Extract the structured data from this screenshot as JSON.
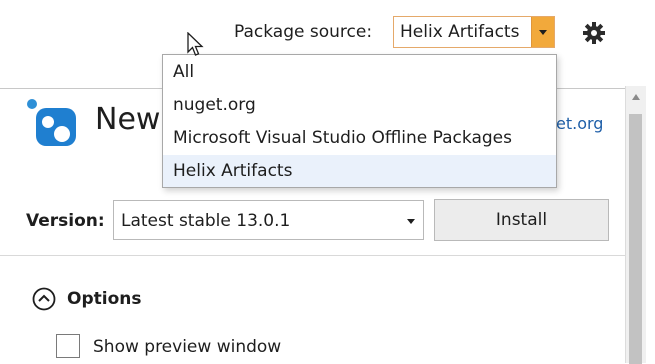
{
  "header": {
    "package_source_label": "Package source:",
    "package_source_value": "Helix Artifacts",
    "settings_icon": "gear-icon"
  },
  "dropdown": {
    "options": [
      "All",
      "nuget.org",
      "Microsoft Visual Studio Offline Packages",
      "Helix Artifacts"
    ],
    "selected": "Helix Artifacts"
  },
  "package": {
    "icon": "nuget-icon",
    "title_visible": "New",
    "link_visible": "et.org"
  },
  "version": {
    "label": "Version:",
    "value": "Latest stable 13.0.1"
  },
  "actions": {
    "install_label": "Install"
  },
  "options": {
    "toggle_icon": "chevron-up-circle-icon",
    "label": "Options",
    "show_preview_label": "Show preview window",
    "show_preview_checked": false
  },
  "colors": {
    "accent": "#f2a93b",
    "link": "#1f5fa8",
    "dropdown_highlight": "#eaf1fb"
  }
}
